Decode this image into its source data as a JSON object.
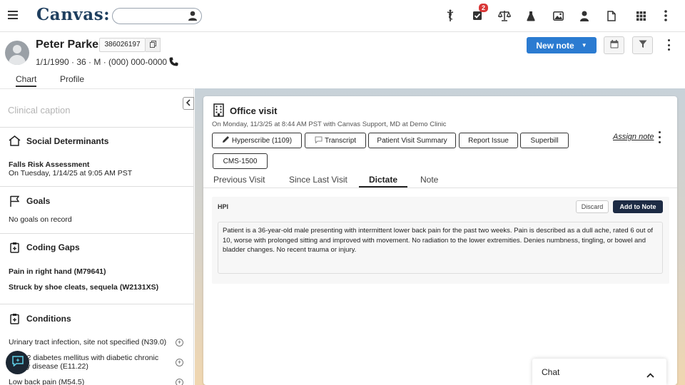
{
  "app": {
    "logo": "Canvas:"
  },
  "search": {
    "placeholder": ""
  },
  "topnav": {
    "icons": [
      "caduceus-icon",
      "tasks-icon",
      "scale-icon",
      "flask-icon",
      "image-icon",
      "person-icon",
      "document-icon",
      "apps-grid-icon",
      "more-vert-icon"
    ],
    "tasks_badge": "2"
  },
  "patient": {
    "name": "Peter Parker",
    "mrn": "386026197",
    "demographics": "1/1/1990 · 36 · M · (000) 000-0000",
    "tabs": [
      "Chart",
      "Profile"
    ],
    "active_tab": "Chart"
  },
  "actions": {
    "new_note": "New note"
  },
  "sidebar": {
    "caption_placeholder": "Clinical caption",
    "social": {
      "title": "Social Determinants",
      "item_title": "Falls Risk Assessment",
      "item_sub": "On Tuesday, 1/14/25 at 9:05 AM PST"
    },
    "goals": {
      "title": "Goals",
      "empty": "No goals on record"
    },
    "coding_gaps": {
      "title": "Coding Gaps",
      "items": [
        "Pain in right hand (M79641)",
        "Struck by shoe cleats, sequela (W2131XS)"
      ]
    },
    "conditions": {
      "title": "Conditions",
      "items": [
        "Urinary tract infection, site not specified (N39.0)",
        "Type 2 diabetes mellitus with diabetic chronic",
        "kidney disease (E11.22)",
        "Low back pain (M54.5)"
      ]
    }
  },
  "visit": {
    "title": "Office visit",
    "subtitle": "On Monday, 11/3/25 at 8:44 AM PST with Canvas Support, MD at Demo Clinic",
    "buttons": {
      "hyperscribe": "Hyperscribe (1109)",
      "transcript": "Transcript",
      "summary": "Patient Visit Summary",
      "report": "Report Issue",
      "superbill": "Superbill",
      "cms": "CMS-1500"
    },
    "assign_note": "Assign note",
    "tabs": [
      "Previous Visit",
      "Since Last Visit",
      "Dictate",
      "Note"
    ],
    "active_tab": "Dictate"
  },
  "hpi": {
    "label": "HPI",
    "discard": "Discard",
    "add_to_note": "Add to Note",
    "text": "Patient is a 36-year-old male presenting with intermittent lower back pain for the past two weeks. Pain is described as a dull ache, rated 6 out of 10, worse with prolonged sitting and improved with movement. No radiation to the lower extremities. Denies numbness, tingling, or bowel and bladder changes. No recent trauma or injury."
  },
  "chat": {
    "label": "Chat"
  }
}
